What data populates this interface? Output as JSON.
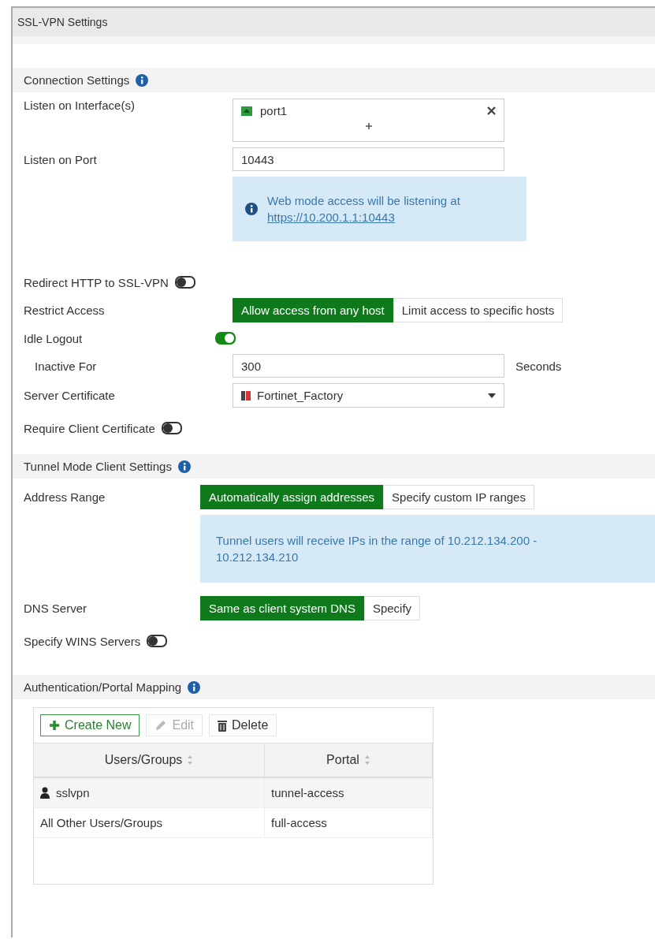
{
  "window": {
    "title": "SSL-VPN Settings"
  },
  "sections": [
    {
      "title": "Connection Settings",
      "rows": [
        {
          "kind": "interfaces",
          "label": "Listen on Interface(s)",
          "value": "port1"
        },
        {
          "kind": "input",
          "label": "Listen on Port",
          "value": "10443"
        },
        {
          "kind": "notice",
          "text": "Web mode access will be listening at",
          "link": "https://10.200.1.1:10443"
        },
        {
          "kind": "toggle",
          "label": "Redirect HTTP to SSL-VPN",
          "on": false
        },
        {
          "kind": "segmented",
          "label": "Restrict Access",
          "options": [
            {
              "label": "Allow access from any host",
              "selected": true
            },
            {
              "label": "Limit access to specific hosts",
              "selected": false
            }
          ]
        },
        {
          "kind": "toggle",
          "label": "Idle Logout",
          "on": true
        },
        {
          "kind": "input",
          "label": "Inactive For",
          "value": "300",
          "suffix": "Seconds",
          "indented": true
        },
        {
          "kind": "select",
          "label": "Server Certificate",
          "value": "Fortinet_Factory"
        },
        {
          "kind": "toggle",
          "label": "Require Client Certificate",
          "on": false
        }
      ]
    },
    {
      "title": "Tunnel Mode Client Settings",
      "rows": [
        {
          "kind": "segmented",
          "label": "Address Range",
          "options": [
            {
              "label": "Automatically assign addresses",
              "selected": true
            },
            {
              "label": "Specify custom IP ranges",
              "selected": false
            }
          ]
        },
        {
          "kind": "notice",
          "text": "Tunnel users will receive IPs in the range of 10.212.134.200 - 10.212.134.210"
        },
        {
          "kind": "segmented",
          "label": "DNS Server",
          "options": [
            {
              "label": "Same as client system DNS",
              "selected": true
            },
            {
              "label": "Specify",
              "selected": false
            }
          ]
        },
        {
          "kind": "toggle",
          "label": "Specify WINS Servers",
          "on": false
        }
      ]
    }
  ],
  "auth": {
    "title": "Authentication/Portal Mapping",
    "toolbar": [
      {
        "kind": "create",
        "label": "Create New",
        "disabled": false
      },
      {
        "kind": "edit",
        "label": "Edit",
        "disabled": true
      },
      {
        "kind": "delete",
        "label": "Delete",
        "disabled": false
      }
    ],
    "columns": [
      "Users/Groups",
      "Portal"
    ],
    "rows": [
      {
        "kind": "user",
        "cells": [
          "sslvpn",
          "tunnel-access"
        ]
      },
      {
        "kind": "other",
        "cells": [
          "All Other Users/Groups",
          "full-access"
        ]
      }
    ]
  }
}
